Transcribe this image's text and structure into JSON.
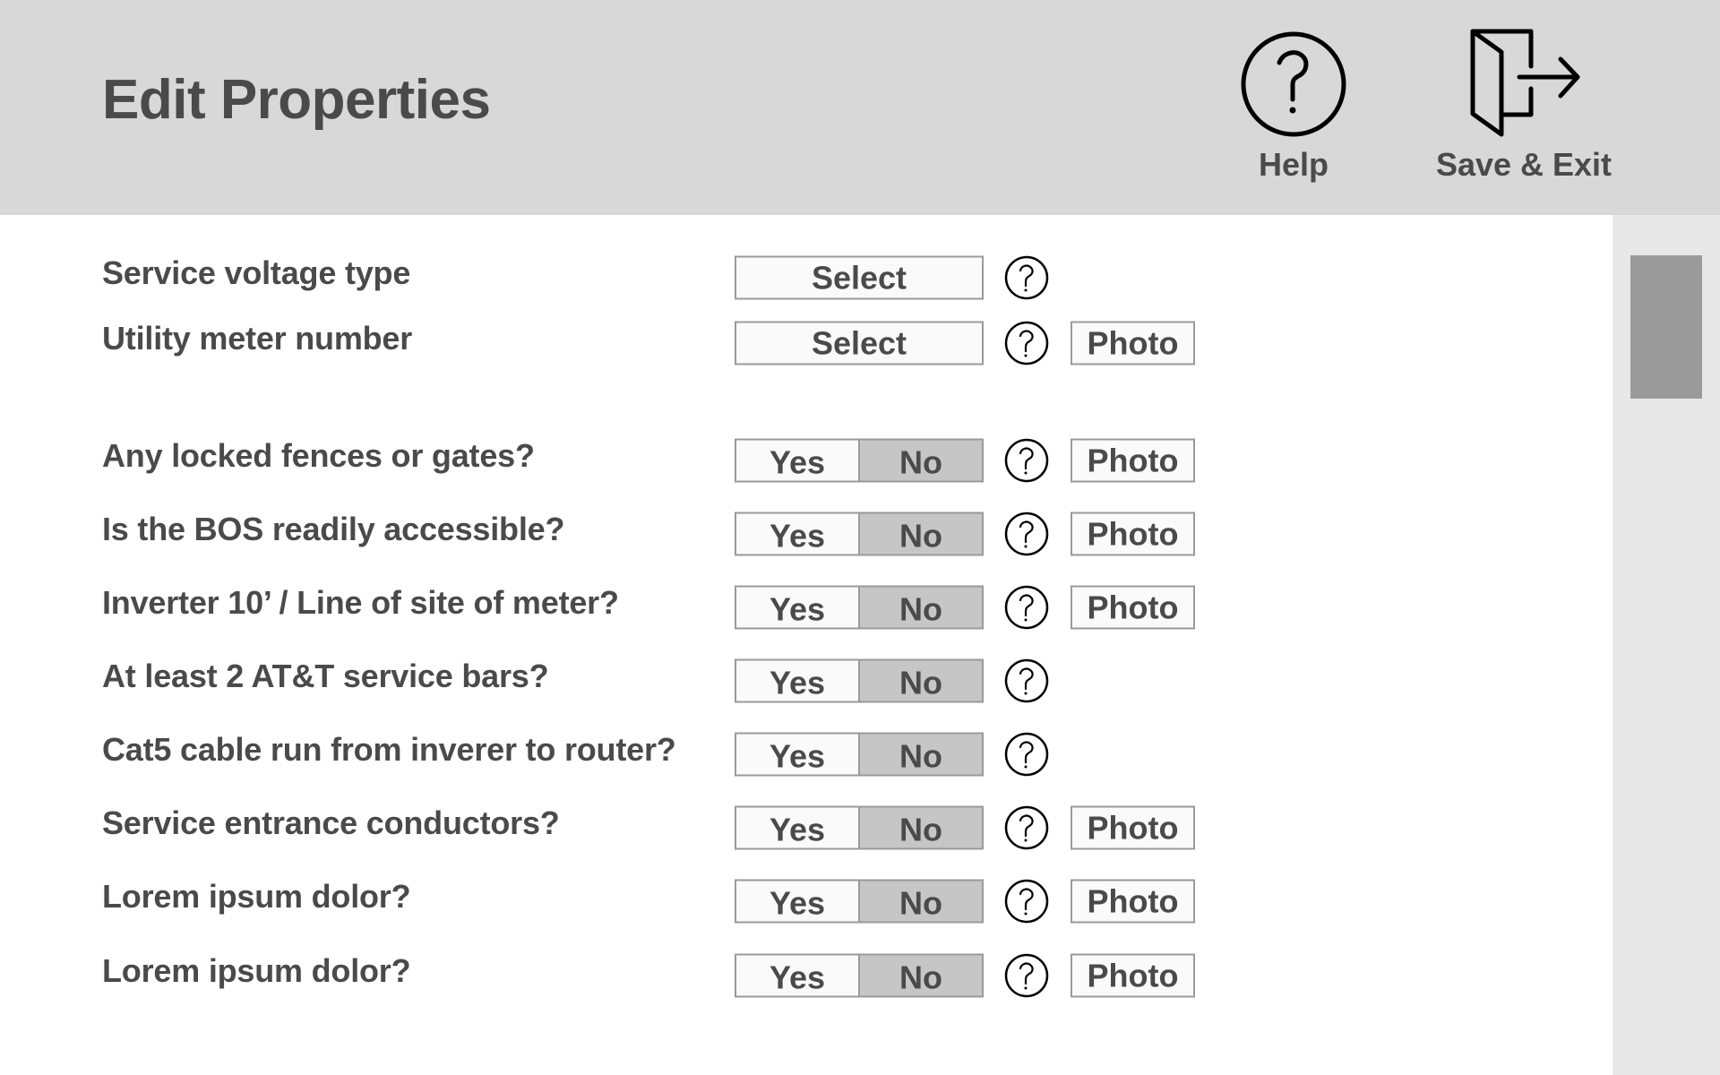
{
  "header": {
    "title": "Edit Properties",
    "help_label": "Help",
    "save_exit_label": "Save & Exit"
  },
  "colors": {
    "header_bg": "#d8d8d8",
    "text": "#4a4a4a",
    "selected_segment": "#c6c6c6",
    "scrollbar_thumb": "#9a9a9a"
  },
  "icons": {
    "help": "question-circle-icon",
    "save_exit": "door-exit-icon",
    "row_help": "question-circle-icon"
  },
  "rows": [
    {
      "label": "Service voltage type",
      "type": "select",
      "value": "Select",
      "photo": null
    },
    {
      "label": "Utility meter number",
      "type": "select",
      "value": "Select",
      "photo": "Photo"
    },
    {
      "label": "Any locked fences or gates?",
      "type": "yesno",
      "yes": "Yes",
      "no": "No",
      "selected": "No",
      "photo": "Photo"
    },
    {
      "label": "Is the BOS readily accessible?",
      "type": "yesno",
      "yes": "Yes",
      "no": "No",
      "selected": "No",
      "photo": "Photo"
    },
    {
      "label": "Inverter 10’ / Line of site of meter?",
      "type": "yesno",
      "yes": "Yes",
      "no": "No",
      "selected": "No",
      "photo": "Photo"
    },
    {
      "label": "At least 2 AT&T service bars?",
      "type": "yesno",
      "yes": "Yes",
      "no": "No",
      "selected": "No",
      "photo": null
    },
    {
      "label": "Cat5 cable run from inverer to router?",
      "type": "yesno",
      "yes": "Yes",
      "no": "No",
      "selected": "No",
      "photo": null
    },
    {
      "label": "Service entrance conductors?",
      "type": "yesno",
      "yes": "Yes",
      "no": "No",
      "selected": "No",
      "photo": "Photo"
    },
    {
      "label": "Lorem ipsum dolor?",
      "type": "yesno",
      "yes": "Yes",
      "no": "No",
      "selected": "No",
      "photo": "Photo"
    },
    {
      "label": "Lorem ipsum dolor?",
      "type": "yesno",
      "yes": "Yes",
      "no": "No",
      "selected": "No",
      "photo": "Photo"
    }
  ]
}
